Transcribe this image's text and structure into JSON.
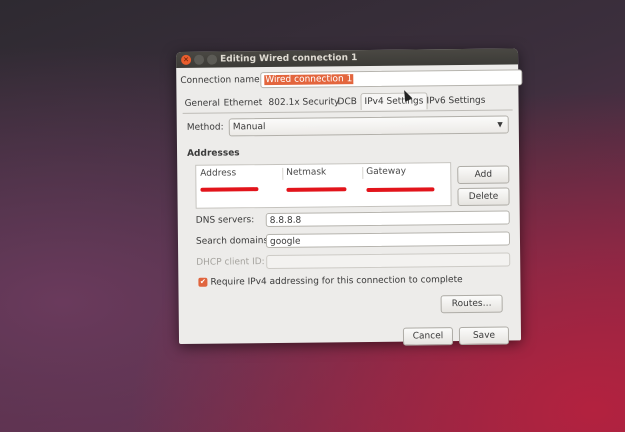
{
  "window": {
    "title": "Editing Wired connection 1"
  },
  "connection": {
    "label": "Connection name:",
    "value": "Wired connection 1"
  },
  "tabs": [
    {
      "label": "General"
    },
    {
      "label": "Ethernet"
    },
    {
      "label": "802.1x Security"
    },
    {
      "label": "DCB"
    },
    {
      "label": "IPv4 Settings",
      "active": true
    },
    {
      "label": "IPv6 Settings"
    }
  ],
  "method": {
    "label": "Method:",
    "value": "Manual"
  },
  "addresses": {
    "heading": "Addresses",
    "columns": [
      "Address",
      "Netmask",
      "Gateway"
    ],
    "add_label": "Add",
    "delete_label": "Delete"
  },
  "dns": {
    "label": "DNS servers:",
    "value": "8.8.8.8"
  },
  "search_domains": {
    "label": "Search domains:",
    "value": "google"
  },
  "dhcp_client_id": {
    "label": "DHCP client ID:",
    "value": ""
  },
  "require_ipv4": {
    "label": "Require IPv4 addressing for this connection to complete",
    "checked": true
  },
  "routes_label": "Routes…",
  "footer": {
    "cancel_label": "Cancel",
    "save_label": "Save"
  },
  "colors": {
    "accent": "#e3653d",
    "redaction": "#e2141b",
    "titlebar": "#3c3b37"
  }
}
